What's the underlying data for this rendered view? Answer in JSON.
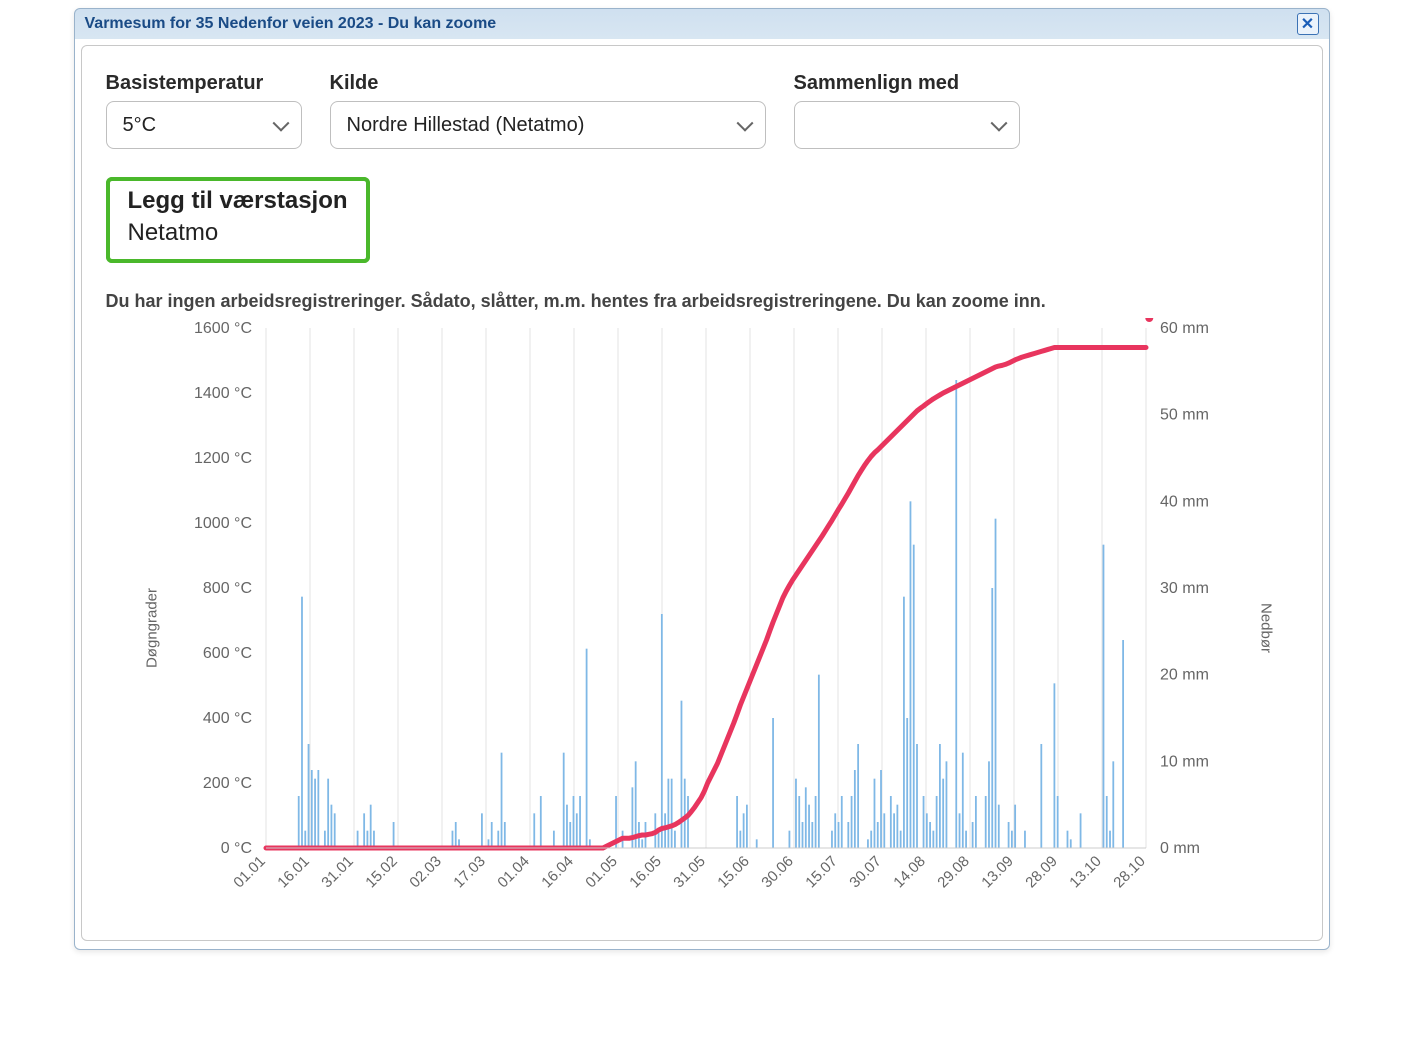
{
  "window": {
    "title": "Varmesum for 35 Nedenfor veien 2023 - Du kan zoome"
  },
  "controls": {
    "basisTemp": {
      "label": "Basistemperatur",
      "value": "5°C"
    },
    "kilde": {
      "label": "Kilde",
      "value": "Nordre Hillestad (Netatmo)"
    },
    "compare": {
      "label": "Sammenlign med",
      "value": ""
    },
    "addStation": {
      "label": "Legg til værstasjon",
      "linkText": "Netatmo"
    }
  },
  "chart": {
    "subtitle": "Du har ingen arbeidsregistreringer. Sådato, slåtter, m.m. hentes fra arbeidsregistreringene. Du kan zoome inn."
  },
  "chart_data": {
    "type": "combo",
    "xTickLabels": [
      "01.01",
      "16.01",
      "31.01",
      "15.02",
      "02.03",
      "17.03",
      "01.04",
      "16.04",
      "01.05",
      "16.05",
      "31.05",
      "15.06",
      "30.06",
      "15.07",
      "30.07",
      "14.08",
      "29.08",
      "13.09",
      "28.09",
      "13.10",
      "28.10"
    ],
    "yLeft": {
      "label": "Døgngrader",
      "min": 0,
      "max": 1600,
      "step": 200,
      "unit": " °C"
    },
    "yRight": {
      "label": "Nedbør",
      "min": 0,
      "max": 60,
      "step": 10,
      "unit": " mm"
    },
    "ylabelLeft": "Døgngrader",
    "ylabelRight": "Nedbør",
    "colors": {
      "line": "#e8355e",
      "bar": "#7fb8e6",
      "grid": "#e3e3e3",
      "axisText": "#666"
    },
    "precip_mm": [
      0,
      0,
      0,
      0,
      0,
      0,
      0,
      0,
      0,
      0,
      6,
      29,
      2,
      12,
      9,
      8,
      9,
      0,
      2,
      8,
      5,
      4,
      0,
      0,
      0,
      0,
      0,
      0,
      2,
      0,
      4,
      2,
      5,
      2,
      0,
      0,
      0,
      0,
      0,
      3,
      0,
      0,
      0,
      0,
      0,
      0,
      0,
      0,
      0,
      0,
      0,
      0,
      0,
      0,
      0,
      0,
      0,
      2,
      3,
      1,
      0,
      0,
      0,
      0,
      0,
      0,
      4,
      0,
      1,
      3,
      0,
      2,
      11,
      3,
      0,
      0,
      0,
      0,
      0,
      0,
      0,
      0,
      4,
      0,
      6,
      0,
      0,
      0,
      2,
      0,
      0,
      11,
      5,
      3,
      6,
      4,
      6,
      0,
      23,
      1,
      0,
      0,
      0,
      0,
      0,
      0,
      0,
      6,
      0,
      2,
      0,
      0,
      7,
      10,
      3,
      1,
      3,
      0,
      0,
      4,
      2,
      27,
      4,
      8,
      8,
      2,
      0,
      17,
      8,
      6,
      0,
      0,
      0,
      0,
      0,
      0,
      0,
      0,
      0,
      0,
      0,
      0,
      0,
      0,
      6,
      2,
      4,
      5,
      0,
      0,
      1,
      0,
      0,
      0,
      0,
      15,
      0,
      0,
      0,
      0,
      2,
      0,
      8,
      6,
      3,
      7,
      5,
      3,
      6,
      20,
      0,
      0,
      0,
      2,
      4,
      3,
      6,
      0,
      3,
      6,
      9,
      12,
      0,
      0,
      1,
      2,
      8,
      3,
      9,
      4,
      0,
      6,
      4,
      5,
      2,
      29,
      15,
      40,
      35,
      12,
      0,
      6,
      4,
      3,
      2,
      6,
      12,
      8,
      10,
      0,
      0,
      54,
      4,
      11,
      2,
      0,
      3,
      6,
      0,
      0,
      6,
      10,
      30,
      38,
      5,
      0,
      0,
      3,
      2,
      5,
      0,
      0,
      2,
      0,
      0,
      0,
      0,
      12,
      0,
      0,
      0,
      19,
      6,
      0,
      0,
      2,
      1,
      0,
      0,
      4,
      0,
      0,
      0,
      0,
      0,
      0,
      35,
      6,
      2,
      10,
      0,
      0,
      24,
      0,
      0,
      0,
      0,
      0,
      0,
      0
    ],
    "degreeDays": [
      0,
      0,
      0,
      0,
      0,
      0,
      0,
      0,
      0,
      0,
      0,
      0,
      0,
      0,
      0,
      0,
      0,
      0,
      0,
      0,
      0,
      0,
      0,
      0,
      0,
      0,
      0,
      0,
      0,
      0,
      0,
      0,
      0,
      0,
      0,
      0,
      0,
      0,
      0,
      0,
      0,
      0,
      0,
      0,
      0,
      0,
      0,
      0,
      0,
      0,
      0,
      0,
      0,
      0,
      0,
      0,
      0,
      0,
      0,
      0,
      0,
      0,
      0,
      0,
      0,
      0,
      0,
      0,
      0,
      0,
      0,
      0,
      0,
      0,
      0,
      0,
      0,
      0,
      0,
      0,
      0,
      0,
      0,
      0,
      0,
      0,
      0,
      0,
      0,
      0,
      0,
      0,
      0,
      0,
      0,
      0,
      0,
      0,
      0,
      0,
      0,
      0,
      0,
      0,
      5,
      10,
      15,
      20,
      25,
      30,
      30,
      30,
      32,
      35,
      38,
      40,
      40,
      42,
      44,
      48,
      55,
      60,
      62,
      65,
      68,
      72,
      78,
      85,
      92,
      100,
      112,
      125,
      140,
      155,
      175,
      200,
      220,
      240,
      260,
      285,
      310,
      335,
      360,
      385,
      412,
      440,
      465,
      490,
      515,
      540,
      565,
      590,
      615,
      640,
      668,
      695,
      720,
      745,
      770,
      790,
      808,
      825,
      840,
      855,
      870,
      885,
      900,
      915,
      930,
      945,
      960,
      976,
      992,
      1008,
      1025,
      1042,
      1058,
      1075,
      1092,
      1110,
      1128,
      1146,
      1162,
      1178,
      1192,
      1205,
      1216,
      1225,
      1235,
      1245,
      1255,
      1265,
      1275,
      1285,
      1295,
      1305,
      1315,
      1325,
      1335,
      1345,
      1353,
      1360,
      1368,
      1375,
      1382,
      1388,
      1394,
      1400,
      1405,
      1410,
      1415,
      1420,
      1425,
      1430,
      1435,
      1440,
      1445,
      1450,
      1455,
      1460,
      1465,
      1470,
      1475,
      1480,
      1483,
      1485,
      1488,
      1492,
      1497,
      1502,
      1506,
      1510,
      1513,
      1516,
      1519,
      1522,
      1525,
      1528,
      1531,
      1534,
      1537,
      1540,
      1540,
      1540,
      1540,
      1540,
      1540,
      1540,
      1540,
      1540,
      1540,
      1540,
      1540,
      1540,
      1540,
      1540,
      1540,
      1540,
      1540,
      1540,
      1540,
      1540,
      1540,
      1540,
      1540,
      1540,
      1540,
      1540,
      1540,
      1540
    ],
    "lineEndsAtIndex": 270
  }
}
